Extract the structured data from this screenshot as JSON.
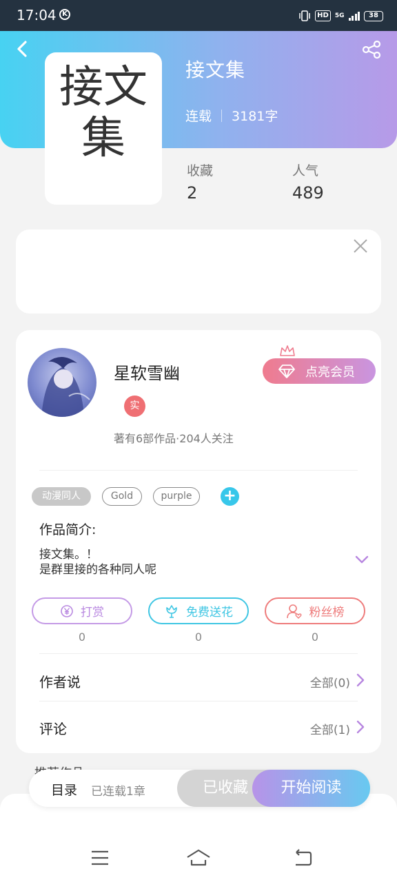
{
  "status_bar": {
    "time": "17:04",
    "k_badge": "K",
    "hd": "HD",
    "network": "5G",
    "battery": "38"
  },
  "book": {
    "title": "接文集",
    "status": "连载",
    "word_count": "3181字",
    "cover_text": "接文集"
  },
  "stats": {
    "collect_label": "收藏",
    "collect_value": "2",
    "popularity_label": "人气",
    "popularity_value": "489"
  },
  "author": {
    "name": "星软雪幽",
    "verified_badge": "实",
    "works_info": "著有6部作品·204人关注",
    "vip_button": "点亮会员"
  },
  "tags": [
    "动漫同人",
    "Gold",
    "purple"
  ],
  "intro": {
    "title": "作品简介:",
    "line1": "接文集。！",
    "line2": "是群里接的各种同人呢"
  },
  "actions": [
    {
      "label": "打赏",
      "count": "0",
      "color": "#b887e0"
    },
    {
      "label": "免费送花",
      "count": "0",
      "color": "#3fc6e3"
    },
    {
      "label": "粉丝榜",
      "count": "0",
      "color": "#ee7b7b"
    }
  ],
  "rows": [
    {
      "label": "作者说",
      "right": "全部(0)"
    },
    {
      "label": "评论",
      "right": "全部(1)"
    }
  ],
  "bottom_bar": {
    "peek_text": "推荐作品",
    "toc_label": "目录",
    "toc_sub": "已连载1章",
    "fav_button": "已收藏",
    "read_button": "开始阅读"
  },
  "colors": {
    "accent_purple": "#b793e8",
    "accent_cyan": "#47d2f2",
    "badge_red": "#ef6f73"
  },
  "icons": [
    "back-icon",
    "share-icon",
    "close-icon",
    "crown-icon",
    "diamond-icon",
    "plus-icon",
    "chevron-down-icon",
    "yen-icon",
    "flower-icon",
    "fan-icon",
    "chevron-right-icon",
    "menu-icon",
    "home-icon",
    "return-icon"
  ]
}
